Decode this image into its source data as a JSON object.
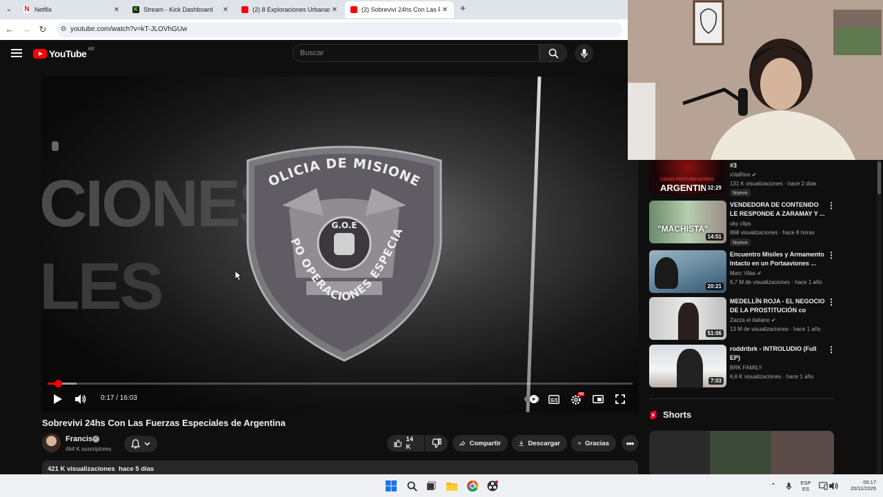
{
  "browser": {
    "tabs": [
      {
        "title": "Netflix",
        "favicon_color": "#e50914",
        "active": false
      },
      {
        "title": "Stream - Kick Dashboard",
        "favicon_color": "#53fc18",
        "active": false
      },
      {
        "title": "(2) 8 Exploraciones Urbanas qu",
        "favicon_color": "#ff0000",
        "active": false
      },
      {
        "title": "(2) Sobrevivi 24hs Con Las Fuer",
        "favicon_color": "#ff0000",
        "active": true
      }
    ],
    "new_tab_label": "+",
    "url": "youtube.com/watch?v=kT-JLOVhGUw"
  },
  "youtube": {
    "logo_text": "YouTube",
    "region": "AR",
    "search_placeholder": "Buscar"
  },
  "player": {
    "badge_top_text": "POLICIA DE MISIONES",
    "badge_bottom_text": "GRUPO OPERACIONES ESPECIALES",
    "badge_center_text": "G.O.E",
    "wall_text_1": "CIONES",
    "wall_text_2": "LES",
    "current_time": "0:17",
    "duration": "16:03",
    "time_display": "0:17 / 16:03",
    "progress_fraction": 0.0177,
    "buffer_fraction": 0.05,
    "settings_badge": "HD"
  },
  "video": {
    "title": "Sobrevivi 24hs Con Las Fuerzas Especiales de Argentina",
    "channel": "Francis",
    "subscribers": "464 K suscriptores",
    "likes": "14 K",
    "share_label": "Compartir",
    "download_label": "Descargar",
    "thanks_label": "Gracias",
    "views": "421 K visualizaciones",
    "age": "hace 5 días"
  },
  "sidebar": {
    "recommendations": [
      {
        "title": "#3",
        "channel": "xVaRion",
        "verified": true,
        "views": "131 K visualizaciones",
        "age": "hace 2 días",
        "duration": "32:29",
        "badge": "Nuevo",
        "thumb_text": "ARGENTIN",
        "thumb_small": "CASOS PERTURBADORES"
      },
      {
        "title": "VENDEDORA DE CONTENIDO LE RESPONDE A ZARAMAY Y ...",
        "channel": "oky clips",
        "verified": false,
        "views": "868 visualizaciones",
        "age": "hace 8 horas",
        "duration": "14:51",
        "badge": "Nuevo",
        "thumb_text": "\"MACHISTA\""
      },
      {
        "title": "Encuentro Misiles y Armamento Intacto en un Portaaviones ...",
        "channel": "Marc Vilas",
        "verified": true,
        "views": "6,7 M de visualizaciones",
        "age": "hace 1 año",
        "duration": "20:21"
      },
      {
        "title": "MEDELLÍN ROJA - EL NEGOCIO DE LA PROSTITUCIÓN co",
        "channel": "Zazza el italiano",
        "verified": true,
        "views": "13 M de visualizaciones",
        "age": "hace 1 año",
        "duration": "51:06"
      },
      {
        "title": "roddribrk - INTROLUDIO (Full EP)",
        "channel": "BRK FAMILY",
        "verified": false,
        "views": "6,6 K visualizaciones",
        "age": "hace 1 año",
        "duration": "7:03"
      }
    ],
    "shorts_title": "Shorts"
  },
  "taskbar": {
    "language_top": "ESP",
    "language_bottom": "ES",
    "time": "00:17",
    "date": "20/11/2025"
  },
  "colors": {
    "yt_red": "#ff0000",
    "background": "#0f0f0f",
    "chip": "#272727"
  }
}
